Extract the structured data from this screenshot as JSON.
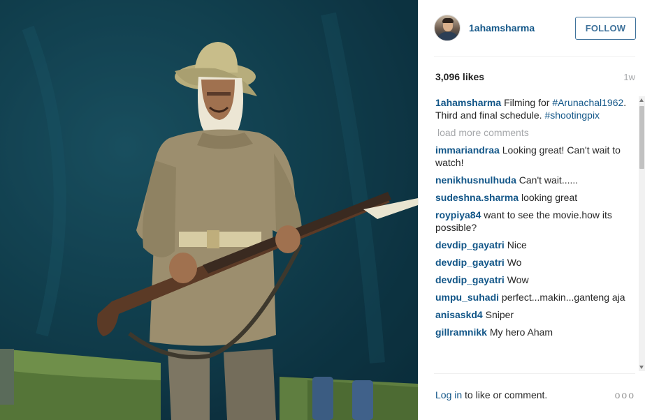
{
  "post": {
    "username": "1ahamsharma",
    "follow_label": "FOLLOW",
    "likes": "3,096 likes",
    "time_ago": "1w"
  },
  "caption": {
    "user": "1ahamsharma",
    "text_1": "Filming for",
    "hashtag_1": "#Arunachal1962",
    "text_2": ". Third and final schedule.",
    "hashtag_2": "#shootingpix"
  },
  "load_more": "load more comments",
  "comments": [
    {
      "user": "immariandraa",
      "text": "Looking great! Can't wait to watch!"
    },
    {
      "user": "nenikhusnulhuda",
      "text": "Can't wait......"
    },
    {
      "user": "sudeshna.sharma",
      "text": "looking great"
    },
    {
      "user": "roypiya84",
      "text": "want to see the movie.how its possible?"
    },
    {
      "user": "devdip_gayatri",
      "text": "Nice"
    },
    {
      "user": "devdip_gayatri",
      "text": "Wo"
    },
    {
      "user": "devdip_gayatri",
      "text": "Wow"
    },
    {
      "user": "umpu_suhadi",
      "text": "perfect...makin...ganteng aja"
    },
    {
      "user": "anisaskd4",
      "text": "Sniper"
    },
    {
      "user": "gillramnikk",
      "text": "My hero Aham"
    }
  ],
  "footer": {
    "login_link": "Log in",
    "login_rest": " to like or comment.",
    "more_options": "ooo"
  },
  "colors": {
    "username_blue": "#125688",
    "follow_border": "#3f729b",
    "muted": "#a5a7aa"
  },
  "icons": {
    "more_options": "three-dots-icon"
  }
}
